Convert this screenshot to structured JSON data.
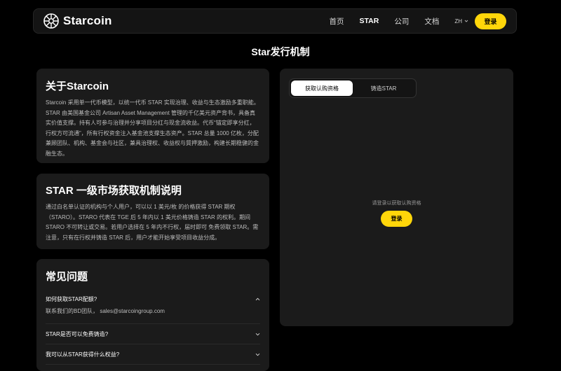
{
  "nav": {
    "brand": "Starcoin",
    "links": [
      "首页",
      "STAR",
      "公司",
      "文档"
    ],
    "lang": "ZH",
    "login": "登录"
  },
  "page_title": "Star发行机制",
  "about": {
    "title": "关于Starcoin",
    "body": "Starcoin 采用单一代币模型，以统一代币 STAR 实现治理、收益与生态激励多重职能。STAR 由美国基金公司 Artisan Asset Management 管理的千亿美元资产背书，具备真实价值支撑。持有人可参与治理并分享项目分红与现金流收益。代币“锚定即享分红，行权方可流通”，所有行权资金注入基金池支撑生态资产。STAR 总量 1000 亿枚，分配兼顾团队、机构、基金会与社区，兼具治理权、收益权与質押激励，构建长期稳健的金融生态。"
  },
  "market": {
    "title": "STAR 一级市场获取机制说明",
    "body": "通过白名单认证的机构与个人用户，可以以 1 美元/枚 的价格获得 STAR 期权（STARO）。STARO 代表在 TGE 后 5 年内以 1 美元价格铸造 STAR 的权利。期间 STARO 不可转让或交易。若用户选择在 5 年内不行权，届时即可 免费领取 STAR。需注意，只有在行权并铸造 STAR 后，用户才能开始享受项目收益分成。"
  },
  "faq": {
    "title": "常见问题",
    "items": [
      {
        "q": "如何获取STAR配额?",
        "a": "联系我们的BD团队， sales@starcoingroup.com"
      },
      {
        "q": "STAR是否可以免费铸造?"
      },
      {
        "q": "我可以从STAR获得什么权益?"
      }
    ]
  },
  "panel": {
    "tabs": [
      "获取认购资格",
      "铸造STAR"
    ],
    "prompt": "请登录以获取认购资格",
    "login": "登录"
  },
  "colors": {
    "accent": "#ffd60a",
    "background": "#000000",
    "card": "#1b1b1b"
  }
}
